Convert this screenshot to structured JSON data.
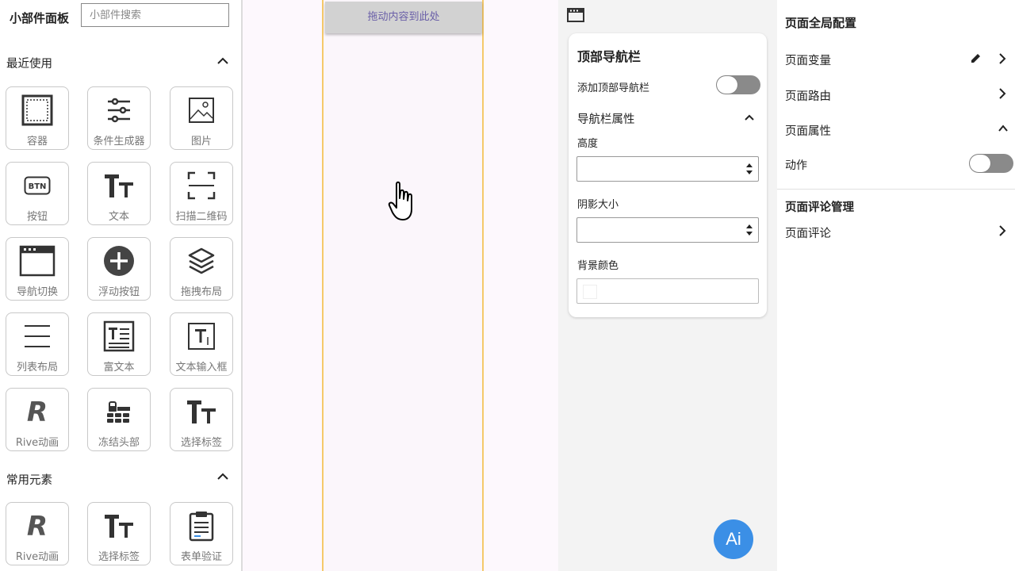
{
  "left_panel": {
    "title": "小部件面板",
    "search_placeholder": "小部件搜索",
    "recent_title": "最近使用",
    "common_title": "常用元素",
    "recent_items": [
      {
        "label": "容器",
        "icon": "container-icon"
      },
      {
        "label": "条件生成器",
        "icon": "sliders-icon"
      },
      {
        "label": "图片",
        "icon": "image-icon"
      },
      {
        "label": "按钮",
        "icon": "btn-icon"
      },
      {
        "label": "文本",
        "icon": "text-icon"
      },
      {
        "label": "扫描二维码",
        "icon": "scan-icon"
      },
      {
        "label": "导航切换",
        "icon": "window-icon"
      },
      {
        "label": "浮动按钮",
        "icon": "plus-circle-icon"
      },
      {
        "label": "拖拽布局",
        "icon": "layers-icon"
      },
      {
        "label": "列表布局",
        "icon": "list-icon"
      },
      {
        "label": "富文本",
        "icon": "rich-text-icon"
      },
      {
        "label": "文本输入框",
        "icon": "text-input-icon"
      },
      {
        "label": "Rive动画",
        "icon": "rive-icon"
      },
      {
        "label": "冻结头部",
        "icon": "freeze-header-icon"
      },
      {
        "label": "选择标签",
        "icon": "text-icon"
      }
    ],
    "common_items": [
      {
        "label": "Rive动画",
        "icon": "rive-icon"
      },
      {
        "label": "选择标签",
        "icon": "text-icon"
      },
      {
        "label": "表单验证",
        "icon": "clipboard-icon"
      }
    ]
  },
  "canvas": {
    "dropzone_text": "拖动内容到此处"
  },
  "properties": {
    "card_title": "顶部导航栏",
    "add_navbar_label": "添加顶部导航栏",
    "add_navbar_enabled": false,
    "group_title": "导航栏属性",
    "height_label": "高度",
    "height_value": "",
    "shadow_label": "阴影大小",
    "shadow_value": "",
    "bg_color_label": "背景颜色",
    "ai_button_label": "Ai"
  },
  "global_config": {
    "title": "页面全局配置",
    "page_variables": "页面变量",
    "page_routes": "页面路由",
    "page_attributes": "页面属性",
    "action_label": "动作",
    "action_enabled": false,
    "comments_title": "页面评论管理",
    "page_comments": "页面评论"
  },
  "colors": {
    "accent_blue": "#3b8fe6",
    "phone_border": "#f5c96a",
    "dropzone_text": "#6a5fa8",
    "toggle_off": "#8a8a8a"
  }
}
